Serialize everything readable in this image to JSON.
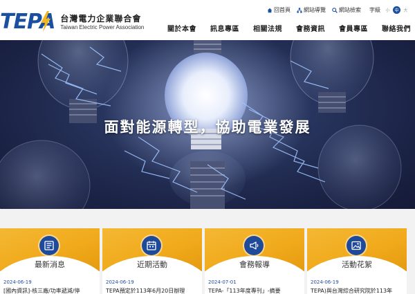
{
  "org": {
    "name_zh": "台灣電力企業聯合會",
    "name_en": "Taiwan Electric Power Association",
    "logo_text": "TEPA"
  },
  "utility": {
    "links": [
      {
        "label": "回首頁",
        "icon": "home-icon"
      },
      {
        "label": "網站導覽",
        "icon": "sitemap-icon"
      },
      {
        "label": "網站檢索",
        "icon": "search-icon"
      }
    ],
    "font_size_label": "字級",
    "font_sizes": [
      "小",
      "中",
      "大"
    ],
    "font_size_active": "中"
  },
  "nav": {
    "items": [
      "關於本會",
      "訊息專區",
      "相關法規",
      "會務資訊",
      "會員專區",
      "聯絡我們"
    ]
  },
  "banner": {
    "title": "面對能源轉型，協助電業發展",
    "slide_count": 3,
    "active_slide": 1
  },
  "cards": [
    {
      "title": "最新消息",
      "icon": "newspaper-icon",
      "date": "2024-06-19",
      "text": "[國內資訊]-核三廠/功率遞減/停"
    },
    {
      "title": "近期活動",
      "icon": "calendar-icon",
      "date": "2024-06-19",
      "text": "TEPA預定於113年6月20日辦理"
    },
    {
      "title": "會務報導",
      "icon": "megaphone-icon",
      "date": "2024-07-01",
      "text": "TEPA-「113年度專刊」-摘要"
    },
    {
      "title": "活動花絮",
      "icon": "photo-icon",
      "date": "2024-06-19",
      "text": "TEPA)與台灣綜合研究院於113年"
    }
  ],
  "colors": {
    "brand_blue": "#1b4fa0",
    "accent_yellow": "#f0a91a",
    "icon_blue": "#1f4a9a"
  }
}
